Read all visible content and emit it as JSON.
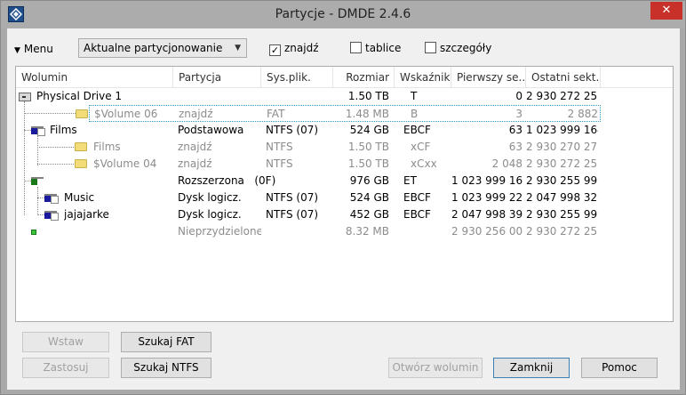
{
  "window": {
    "title": "Partycje - DMDE 2.4.6",
    "close_glyph": "✕"
  },
  "toolbar": {
    "menu_label": "Menu",
    "view_select_value": "Aktualne partycjonowanie",
    "find_checkbox": {
      "label": "znajdź",
      "checked": true
    },
    "tables_checkbox": {
      "label": "tablice",
      "checked": false
    },
    "details_checkbox": {
      "label": "szczegóły",
      "checked": false
    }
  },
  "columns": [
    "Wolumin",
    "Partycja",
    "Sys.plik.",
    "Rozmiar",
    "Wskaźniki",
    "Pierwszy se...",
    "Ostatni sekt..."
  ],
  "rows": [
    {
      "name": "Physical Drive 1",
      "partition": "",
      "fs": "",
      "size": "1.50 TB",
      "flags": "T",
      "first": "0",
      "last": "2 930 272 255",
      "icon": "disk-icon",
      "gray": false
    },
    {
      "name": "$Volume 06",
      "partition": "znajdź",
      "fs": "FAT",
      "size": "1.48 MB",
      "flags": "B",
      "first": "3",
      "last": "2 882",
      "icon": "folder-icon",
      "gray": true
    },
    {
      "name": "Films",
      "partition": "Podstawowa",
      "fs": "NTFS (07)",
      "size": "524 GB",
      "flags": "EBCF",
      "first": "63",
      "last": "1 023 999 164",
      "icon": "partition-icon",
      "gray": false
    },
    {
      "name": "Films",
      "partition": "znajdź",
      "fs": "NTFS",
      "size": "1.50 TB",
      "flags": "xCF",
      "first": "63",
      "last": "2 930 270 270",
      "icon": "folder-icon",
      "gray": true
    },
    {
      "name": "$Volume 04",
      "partition": "znajdź",
      "fs": "NTFS",
      "size": "1.50 TB",
      "flags": "xCxx",
      "first": "2 048",
      "last": "2 930 272 255",
      "icon": "folder-icon",
      "gray": true
    },
    {
      "name": "",
      "partition": "Rozszerzona   (0F)",
      "fs": "",
      "size": "976 GB",
      "flags": "ET",
      "first": "1 023 999 165",
      "last": "2 930 255 999",
      "icon": "extended-partition-icon",
      "gray": false
    },
    {
      "name": "Music",
      "partition": "Dysk logicz.",
      "fs": "NTFS (07)",
      "size": "524 GB",
      "flags": "EBCF",
      "first": "1 023 999 228",
      "last": "2 047 998 329",
      "icon": "partition-icon",
      "gray": false
    },
    {
      "name": "jajajarke",
      "partition": "Dysk logicz.",
      "fs": "NTFS (07)",
      "size": "452 GB",
      "flags": "EBCF",
      "first": "2 047 998 393",
      "last": "2 930 255 999",
      "icon": "partition-icon",
      "gray": false
    },
    {
      "name": "",
      "partition": "Nieprzydzielone",
      "fs": "",
      "size": "8.32 MB",
      "flags": "",
      "first": "2 930 256 000",
      "last": "2 930 272 255",
      "icon": "unallocated-icon",
      "gray": true
    }
  ],
  "buttons": {
    "insert": "Wstaw",
    "apply": "Zastosuj",
    "search_fat": "Szukaj FAT",
    "search_ntfs": "Szukaj NTFS",
    "open_volume": "Otwórz wolumin",
    "close": "Zamknij",
    "help": "Pomoc"
  }
}
